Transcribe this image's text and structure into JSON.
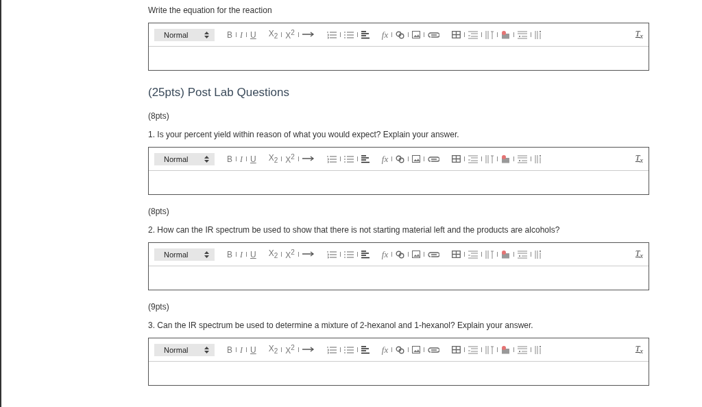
{
  "blocks": [
    {
      "kind": "prompt",
      "text": "Write the equation for the reaction"
    },
    {
      "kind": "editor",
      "toolbar": {
        "format": "Normal",
        "bold": "B",
        "italic": "I",
        "underline": "U",
        "subscript": "X$_{2}$",
        "superscript": "X$^{2}$",
        "formula": "fx",
        "clear": "T$_{x}$"
      }
    },
    {
      "kind": "heading",
      "text": "(25pts) Post Lab Questions"
    },
    {
      "kind": "points",
      "text": "(8pts)"
    },
    {
      "kind": "prompt",
      "text": "1. Is your percent yield within reason of what you would expect? Explain your answer."
    },
    {
      "kind": "editor",
      "toolbar": {
        "format": "Normal",
        "bold": "B",
        "italic": "I",
        "underline": "U",
        "subscript": "X$_{2}$",
        "superscript": "X$^{2}$",
        "formula": "fx",
        "clear": "T$_{x}$"
      }
    },
    {
      "kind": "points",
      "text": "(8pts)"
    },
    {
      "kind": "prompt",
      "text": "2. How can the IR spectrum be used to show that there is not starting material left and the products are alcohols?"
    },
    {
      "kind": "editor",
      "toolbar": {
        "format": "Normal",
        "bold": "B",
        "italic": "I",
        "underline": "U",
        "subscript": "X$_{2}$",
        "superscript": "X$^{2}$",
        "formula": "fx",
        "clear": "T$_{x}$"
      }
    },
    {
      "kind": "points",
      "text": "(9pts)"
    },
    {
      "kind": "prompt",
      "text": "3. Can the IR spectrum be used to determine a mixture of 2-hexanol and 1-hexanol? Explain your answer."
    },
    {
      "kind": "editor",
      "toolbar": {
        "format": "Normal",
        "bold": "B",
        "italic": "I",
        "underline": "U",
        "subscript": "X$_{2}$",
        "superscript": "X$^{2}$",
        "formula": "fx",
        "clear": "T$_{x}$"
      }
    }
  ]
}
